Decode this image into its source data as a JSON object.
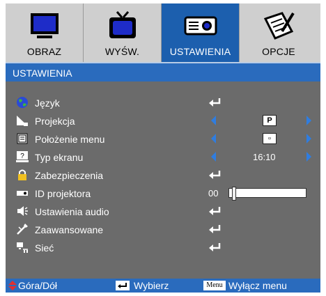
{
  "tabs": [
    {
      "label": "OBRAZ",
      "icon": "monitor-icon",
      "active": false
    },
    {
      "label": "WYŚW.",
      "icon": "tv-icon",
      "active": false
    },
    {
      "label": "USTAWIENIA",
      "icon": "projector-icon",
      "active": true
    },
    {
      "label": "OPCJE",
      "icon": "document-pen-icon",
      "active": false
    }
  ],
  "title": "USTAWIENIA",
  "items": [
    {
      "label": "Język",
      "icon": "globe-icon",
      "control": "enter"
    },
    {
      "label": "Projekcja",
      "icon": "projection-icon",
      "control": "select",
      "value": "P"
    },
    {
      "label": "Położenie menu",
      "icon": "menu-location-icon",
      "control": "select",
      "value": "▫"
    },
    {
      "label": "Typ ekranu",
      "icon": "screen-type-icon",
      "control": "select",
      "value": "16:10"
    },
    {
      "label": "Zabezpieczenia",
      "icon": "lock-icon",
      "control": "enter"
    },
    {
      "label": "ID projektora",
      "icon": "projector-id-icon",
      "control": "slider",
      "value": "00",
      "level": 0
    },
    {
      "label": "Ustawienia audio",
      "icon": "speaker-icon",
      "control": "enter"
    },
    {
      "label": "Zaawansowane",
      "icon": "advanced-icon",
      "control": "enter"
    },
    {
      "label": "Sieć",
      "icon": "network-icon",
      "control": "enter"
    }
  ],
  "footer": {
    "nav": "Góra/Dół",
    "select": "Wybierz",
    "menu_key": "Menu",
    "exit": "Wyłącz menu"
  },
  "colors": {
    "accent": "#2a6bbd",
    "active_tab": "#1c5fae",
    "arrow": "#2f7de0",
    "panel": "#6b6b6b"
  }
}
